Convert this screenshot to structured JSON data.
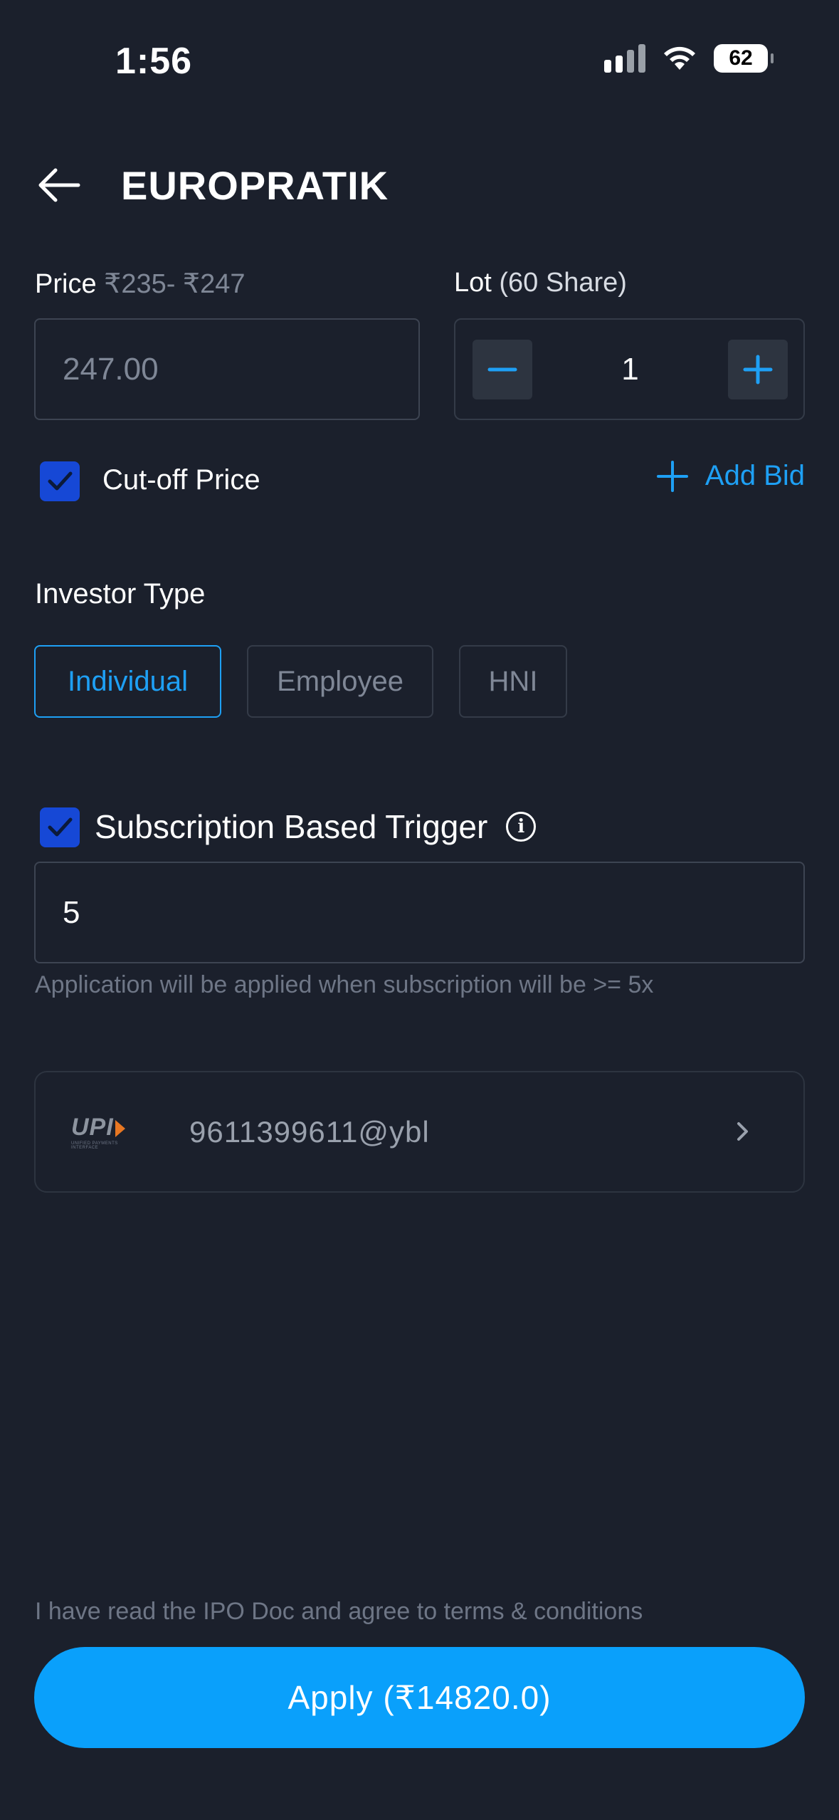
{
  "status_bar": {
    "time": "1:56",
    "battery": "62"
  },
  "header": {
    "title": "EUROPRATIK",
    "back_icon": "arrow-left-icon"
  },
  "price": {
    "label": "Price",
    "range": "₹235- ₹247",
    "placeholder": "247.00"
  },
  "lot": {
    "label": "Lot",
    "shares": "(60 Share)",
    "value": "1"
  },
  "cutoff": {
    "label": "Cut-off Price",
    "checked": true
  },
  "add_bid": {
    "label": "Add Bid"
  },
  "investor_type": {
    "label": "Investor Type",
    "options": [
      "Individual",
      "Employee",
      "HNI"
    ],
    "selected": "Individual"
  },
  "trigger": {
    "label": "Subscription Based Trigger",
    "checked": true,
    "value": "5",
    "helper": "Application will be applied when subscription will be >= 5x"
  },
  "upi": {
    "logo_text": "UPI",
    "logo_sub": "UNIFIED PAYMENTS INTERFACE",
    "id": "9611399611@ybl"
  },
  "footer": {
    "terms": "I have read the IPO Doc and agree to terms & conditions",
    "apply_label": "Apply (₹14820.0)"
  },
  "colors": {
    "background": "#1b202c",
    "accent": "#1ea0f5",
    "apply_button": "#0aa0fb",
    "checkbox": "#1648d6"
  }
}
